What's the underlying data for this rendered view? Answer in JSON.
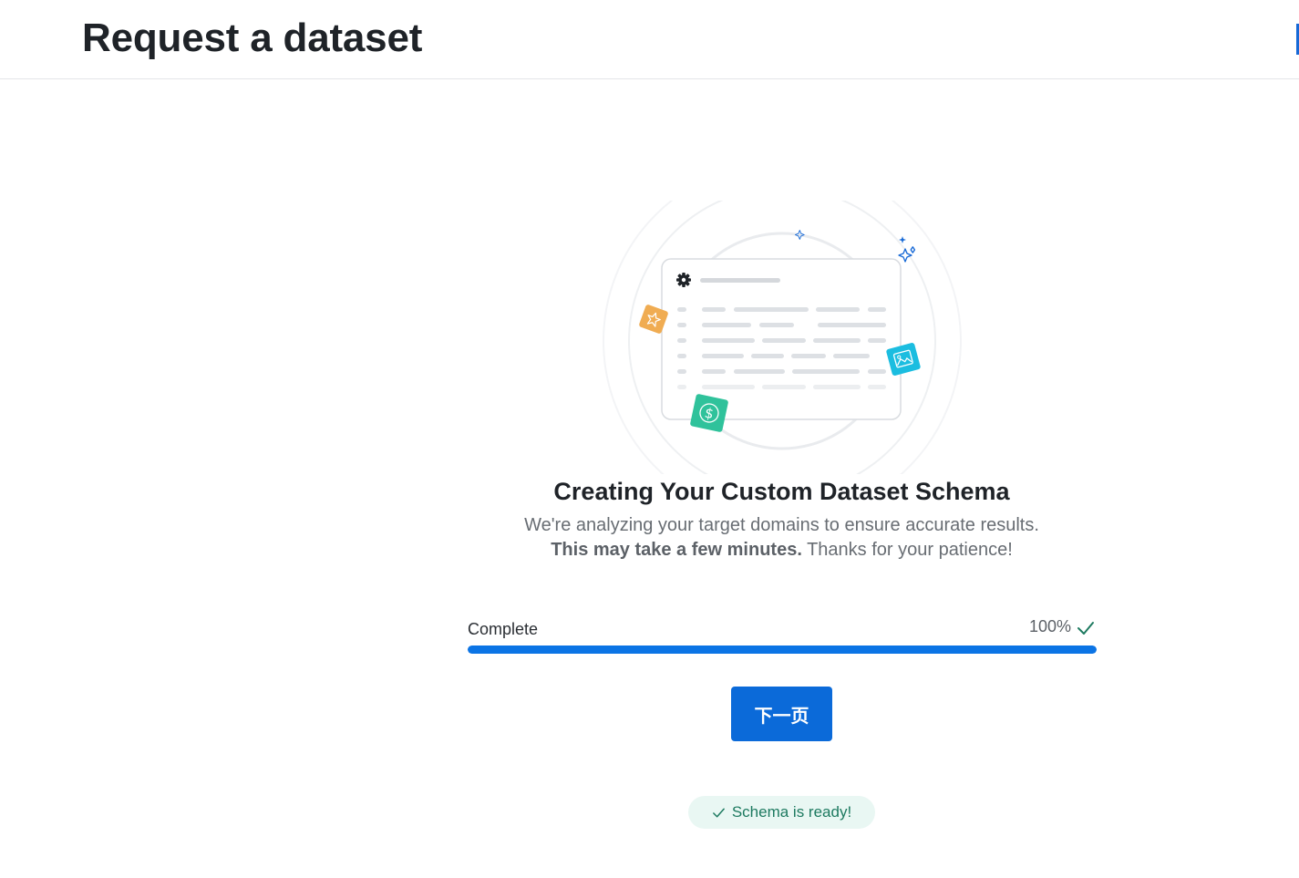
{
  "header": {
    "title": "Request a dataset"
  },
  "main": {
    "heading": "Creating Your Custom Dataset Schema",
    "subtext_line1": "We're analyzing your target domains to ensure accurate results.",
    "subtext_bold": "This may take a few minutes.",
    "subtext_rest": "Thanks for your patience!"
  },
  "progress": {
    "label": "Complete",
    "value_text": "100%",
    "fraction": 1.0,
    "check_icon": "check-icon"
  },
  "actions": {
    "next_label": "下一页"
  },
  "status": {
    "text": "Schema is ready!",
    "icon": "check-icon"
  },
  "colors": {
    "accent": "#0b74e5",
    "button": "#0b6ad9",
    "success": "#1d7a60",
    "success_bg": "#e9f7f3",
    "star_tile": "#f0ac52",
    "image_tile": "#1bbde0",
    "dollar_tile": "#2fc29b",
    "sparkle": "#1769d6"
  },
  "illustration": {
    "icons": [
      "gear-icon",
      "star-icon",
      "image-icon",
      "dollar-icon",
      "sparkle-icon"
    ]
  }
}
